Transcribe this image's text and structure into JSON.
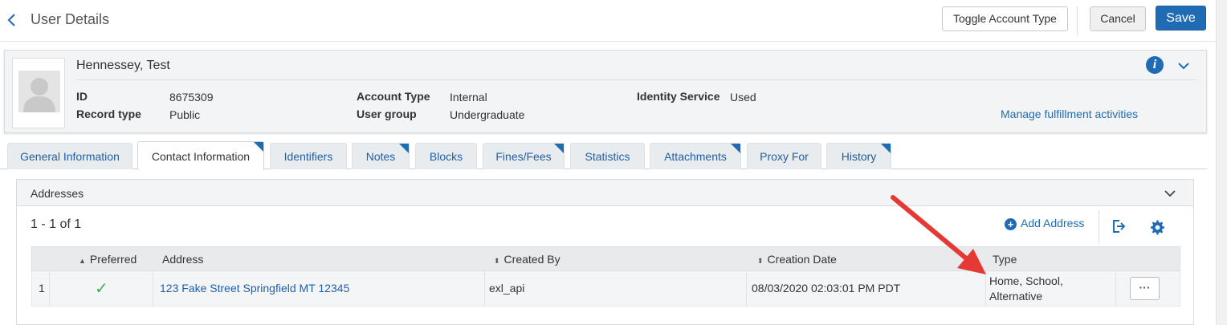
{
  "header": {
    "title": "User Details",
    "toggle_label": "Toggle Account Type",
    "cancel_label": "Cancel",
    "save_label": "Save"
  },
  "user": {
    "name": "Hennessey, Test",
    "id_label": "ID",
    "id_value": "8675309",
    "record_type_label": "Record type",
    "record_type_value": "Public",
    "account_type_label": "Account Type",
    "account_type_value": "Internal",
    "user_group_label": "User group",
    "user_group_value": "Undergraduate",
    "identity_service_label": "Identity Service",
    "identity_service_value": "Used",
    "manage_link": "Manage fulfillment activities"
  },
  "tabs": [
    {
      "label": "General Information",
      "active": false,
      "flag": false
    },
    {
      "label": "Contact Information",
      "active": true,
      "flag": true
    },
    {
      "label": "Identifiers",
      "active": false,
      "flag": false
    },
    {
      "label": "Notes",
      "active": false,
      "flag": true
    },
    {
      "label": "Blocks",
      "active": false,
      "flag": false
    },
    {
      "label": "Fines/Fees",
      "active": false,
      "flag": true
    },
    {
      "label": "Statistics",
      "active": false,
      "flag": false
    },
    {
      "label": "Attachments",
      "active": false,
      "flag": true
    },
    {
      "label": "Proxy For",
      "active": false,
      "flag": false
    },
    {
      "label": "History",
      "active": false,
      "flag": true
    }
  ],
  "addresses": {
    "title": "Addresses",
    "count": "1 - 1 of 1",
    "add_label": "Add Address",
    "columns": [
      "Preferred",
      "Address",
      "Created By",
      "Creation Date",
      "Type"
    ],
    "rows": [
      {
        "index": "1",
        "preferred": "✓",
        "address": "123 Fake Street Springfield MT 12345",
        "created_by": "exl_api",
        "creation_date": "08/03/2020 02:03:01 PM PDT",
        "type_line1": "Home, School,",
        "type_line2": "Alternative",
        "actions": "···"
      }
    ]
  },
  "colors": {
    "accent": "#1f6cb5",
    "link": "#1f5fa8",
    "check": "#3fae5a",
    "annotation_arrow": "#e53935"
  }
}
